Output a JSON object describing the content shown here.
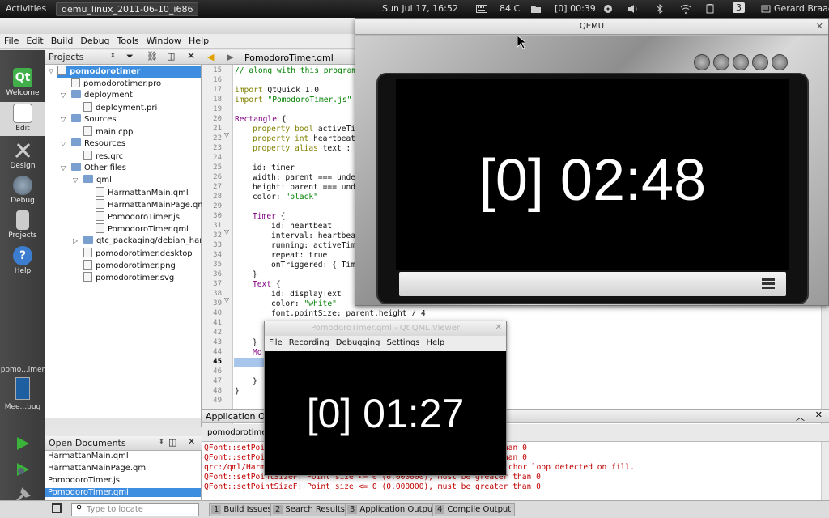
{
  "topbar": {
    "activities": "Activities",
    "window": "qemu_linux_2011-06-10_i686",
    "clock": "Sun Jul 17, 16:52",
    "temp": "84 C",
    "timer": "[0] 00:39",
    "workspace": "3",
    "user": "Gerard Braad"
  },
  "menu": [
    "File",
    "Edit",
    "Build",
    "Debug",
    "Tools",
    "Window",
    "Help"
  ],
  "modes": [
    "Welcome",
    "Edit",
    "Design",
    "Debug",
    "Projects",
    "Help"
  ],
  "kit": {
    "project": "pomo...imer",
    "target": "Mee...bug"
  },
  "projects": {
    "header": "Projects",
    "tree": [
      "pomodorotimer",
      "pomodorotimer.pro",
      "deployment",
      "deployment.pri",
      "Sources",
      "main.cpp",
      "Resources",
      "res.qrc",
      "Other files",
      "qml",
      "HarmattanMain.qml",
      "HarmattanMainPage.qml",
      "PomodoroTimer.js",
      "PomodoroTimer.qml",
      "qtc_packaging/debian_harmattan",
      "pomodorotimer.desktop",
      "pomodorotimer.png",
      "pomodorotimer.svg"
    ]
  },
  "opendocs": {
    "header": "Open Documents",
    "items": [
      "HarmattanMain.qml",
      "HarmattanMainPage.qml",
      "PomodoroTimer.js",
      "PomodoroTimer.qml"
    ]
  },
  "editor": {
    "file": "PomodoroTimer.qml",
    "lines": [
      "15",
      "16",
      "17",
      "18",
      "19",
      "20",
      "21",
      "22",
      "23",
      "24",
      "25",
      "26",
      "27",
      "28",
      "29",
      "30",
      "31",
      "32",
      "33",
      "34",
      "35",
      "36",
      "37",
      "38",
      "39",
      "40",
      "41",
      "42",
      "43",
      "44",
      "45",
      "46",
      "47",
      "48",
      "49"
    ],
    "code": {
      "l15": "// along with this program",
      "l17a": "import",
      "l17b": " QtQuick 1.0",
      "l18a": "import",
      "l18b": " \"PomodoroTimer.js\" a",
      "l20a": "Rectangle",
      "l20b": " {",
      "l21a": "property",
      "l21b": " bool",
      "l21c": " activeTim",
      "l22a": "property",
      "l22b": " int",
      "l22c": " heartbeatI",
      "l23a": "property",
      "l23b": " alias",
      "l23c": " text : d",
      "l25": "id: timer",
      "l26": "width: parent === undef",
      "l27": "height: parent === unde",
      "l28a": "color: ",
      "l28b": "\"black\"",
      "l30a": "Timer",
      "l30b": " {",
      "l31": "id: heartbeat",
      "l32": "interval: heartbeat",
      "l33": "running: activeTime",
      "l34": "repeat: true",
      "l35": "onTriggered: { Time",
      "l36": "}",
      "l37a": "Text",
      "l37b": " {",
      "l38": "id: displayText",
      "l39a": "color: ",
      "l39b": "\"white\"",
      "l40": "font.pointSize: parent.height / 4",
      "l43": "}",
      "l44": "Mo",
      "l47": "}",
      "l48": "}"
    }
  },
  "appoutput": {
    "header": "Application Output",
    "tab": "pomodorotimer",
    "lines": [
      "QFont::setPoi",
      "QFont::setPoi",
      "qrc:/qml/Harm",
      "QFont::setPointSizeF: Point size <= 0 (0.000000), must be greater than 0",
      "QFont::setPointSizeF: Point size <= 0 (0.000000), must be greater than 0"
    ],
    "tails": [
      "han 0",
      "han 0",
      "chor loop detected on fill."
    ]
  },
  "statusbar": {
    "locate_placeholder": "Type to locate",
    "tabs": [
      {
        "n": "1",
        "label": "Build Issues"
      },
      {
        "n": "2",
        "label": "Search Results"
      },
      {
        "n": "3",
        "label": "Application Output"
      },
      {
        "n": "4",
        "label": "Compile Output"
      }
    ]
  },
  "qemu": {
    "title": "QEMU",
    "time": "[0] 02:48"
  },
  "viewer": {
    "title": "PomodoroTimer.qml - Qt QML Viewer",
    "menu": [
      "File",
      "Recording",
      "Debugging",
      "Settings",
      "Help"
    ],
    "time": "[0] 01:27"
  }
}
